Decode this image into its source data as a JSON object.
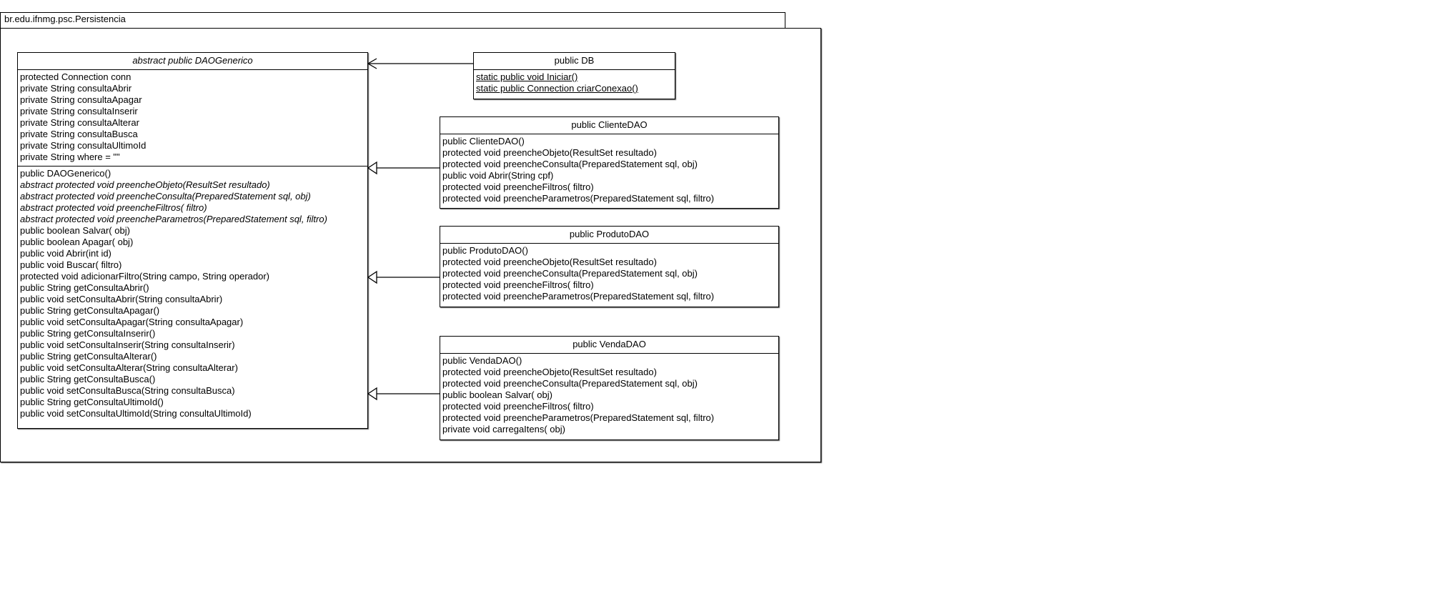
{
  "package": {
    "name": "br.edu.ifnmg.psc.Persistencia"
  },
  "classes": [
    {
      "id": "daogenerico",
      "title": "abstract public DAOGenerico",
      "abstract": true,
      "attributes": [
        {
          "text": "protected Connection conn"
        },
        {
          "text": "private String consultaAbrir"
        },
        {
          "text": "private String consultaApagar"
        },
        {
          "text": "private String consultaInserir"
        },
        {
          "text": "private String consultaAlterar"
        },
        {
          "text": "private String consultaBusca"
        },
        {
          "text": "private String consultaUltimoId"
        },
        {
          "text": "private String where = \"\""
        }
      ],
      "methods": [
        {
          "text": "public DAOGenerico()"
        },
        {
          "text": "abstract protected void preencheObjeto(ResultSet resultado)",
          "italic": true
        },
        {
          "text": "abstract protected void preencheConsulta(PreparedStatement sql,  obj)",
          "italic": true
        },
        {
          "text": "abstract protected void preencheFiltros( filtro)",
          "italic": true
        },
        {
          "text": "abstract protected void preencheParametros(PreparedStatement sql,  filtro)",
          "italic": true
        },
        {
          "text": "public boolean Salvar( obj)"
        },
        {
          "text": "public boolean Apagar( obj)"
        },
        {
          "text": "public void Abrir(int id)"
        },
        {
          "text": "public void Buscar( filtro)"
        },
        {
          "text": "protected void adicionarFiltro(String campo, String operador)"
        },
        {
          "text": "public String getConsultaAbrir()"
        },
        {
          "text": "public void setConsultaAbrir(String consultaAbrir)"
        },
        {
          "text": "public String getConsultaApagar()"
        },
        {
          "text": "public void setConsultaApagar(String consultaApagar)"
        },
        {
          "text": "public String getConsultaInserir()"
        },
        {
          "text": "public void setConsultaInserir(String consultaInserir)"
        },
        {
          "text": "public String getConsultaAlterar()"
        },
        {
          "text": "public void setConsultaAlterar(String consultaAlterar)"
        },
        {
          "text": "public String getConsultaBusca()"
        },
        {
          "text": "public void setConsultaBusca(String consultaBusca)"
        },
        {
          "text": "public String getConsultaUltimoId()"
        },
        {
          "text": "public void setConsultaUltimoId(String consultaUltimoId)"
        }
      ]
    },
    {
      "id": "db",
      "title": "public DB",
      "methods": [
        {
          "text": "static public void Iniciar()",
          "static": true
        },
        {
          "text": "static public Connection criarConexao()",
          "static": true
        }
      ]
    },
    {
      "id": "clientedao",
      "title": "public ClienteDAO",
      "methods": [
        {
          "text": "public ClienteDAO()"
        },
        {
          "text": "protected void preencheObjeto(ResultSet resultado)"
        },
        {
          "text": "protected void preencheConsulta(PreparedStatement sql,  obj)"
        },
        {
          "text": "public void Abrir(String cpf)"
        },
        {
          "text": "protected void preencheFiltros( filtro)"
        },
        {
          "text": "protected void preencheParametros(PreparedStatement sql,  filtro)"
        }
      ]
    },
    {
      "id": "produtodao",
      "title": "public ProdutoDAO",
      "methods": [
        {
          "text": "public ProdutoDAO()"
        },
        {
          "text": "protected void preencheObjeto(ResultSet resultado)"
        },
        {
          "text": "protected void preencheConsulta(PreparedStatement sql,  obj)"
        },
        {
          "text": "protected void preencheFiltros( filtro)"
        },
        {
          "text": "protected void preencheParametros(PreparedStatement sql,  filtro)"
        }
      ]
    },
    {
      "id": "vendadao",
      "title": "public VendaDAO",
      "methods": [
        {
          "text": "public VendaDAO()"
        },
        {
          "text": "protected void preencheObjeto(ResultSet resultado)"
        },
        {
          "text": "protected void preencheConsulta(PreparedStatement sql,  obj)"
        },
        {
          "text": "public boolean Salvar( obj)"
        },
        {
          "text": "protected void preencheFiltros( filtro)"
        },
        {
          "text": "protected void preencheParametros(PreparedStatement sql,  filtro)"
        },
        {
          "text": "private void carregaItens( obj)"
        }
      ]
    }
  ],
  "relations": [
    {
      "from": "db",
      "to": "daogenerico",
      "type": "association"
    },
    {
      "from": "clientedao",
      "to": "daogenerico",
      "type": "generalization"
    },
    {
      "from": "produtodao",
      "to": "daogenerico",
      "type": "generalization"
    },
    {
      "from": "vendadao",
      "to": "daogenerico",
      "type": "generalization"
    }
  ]
}
